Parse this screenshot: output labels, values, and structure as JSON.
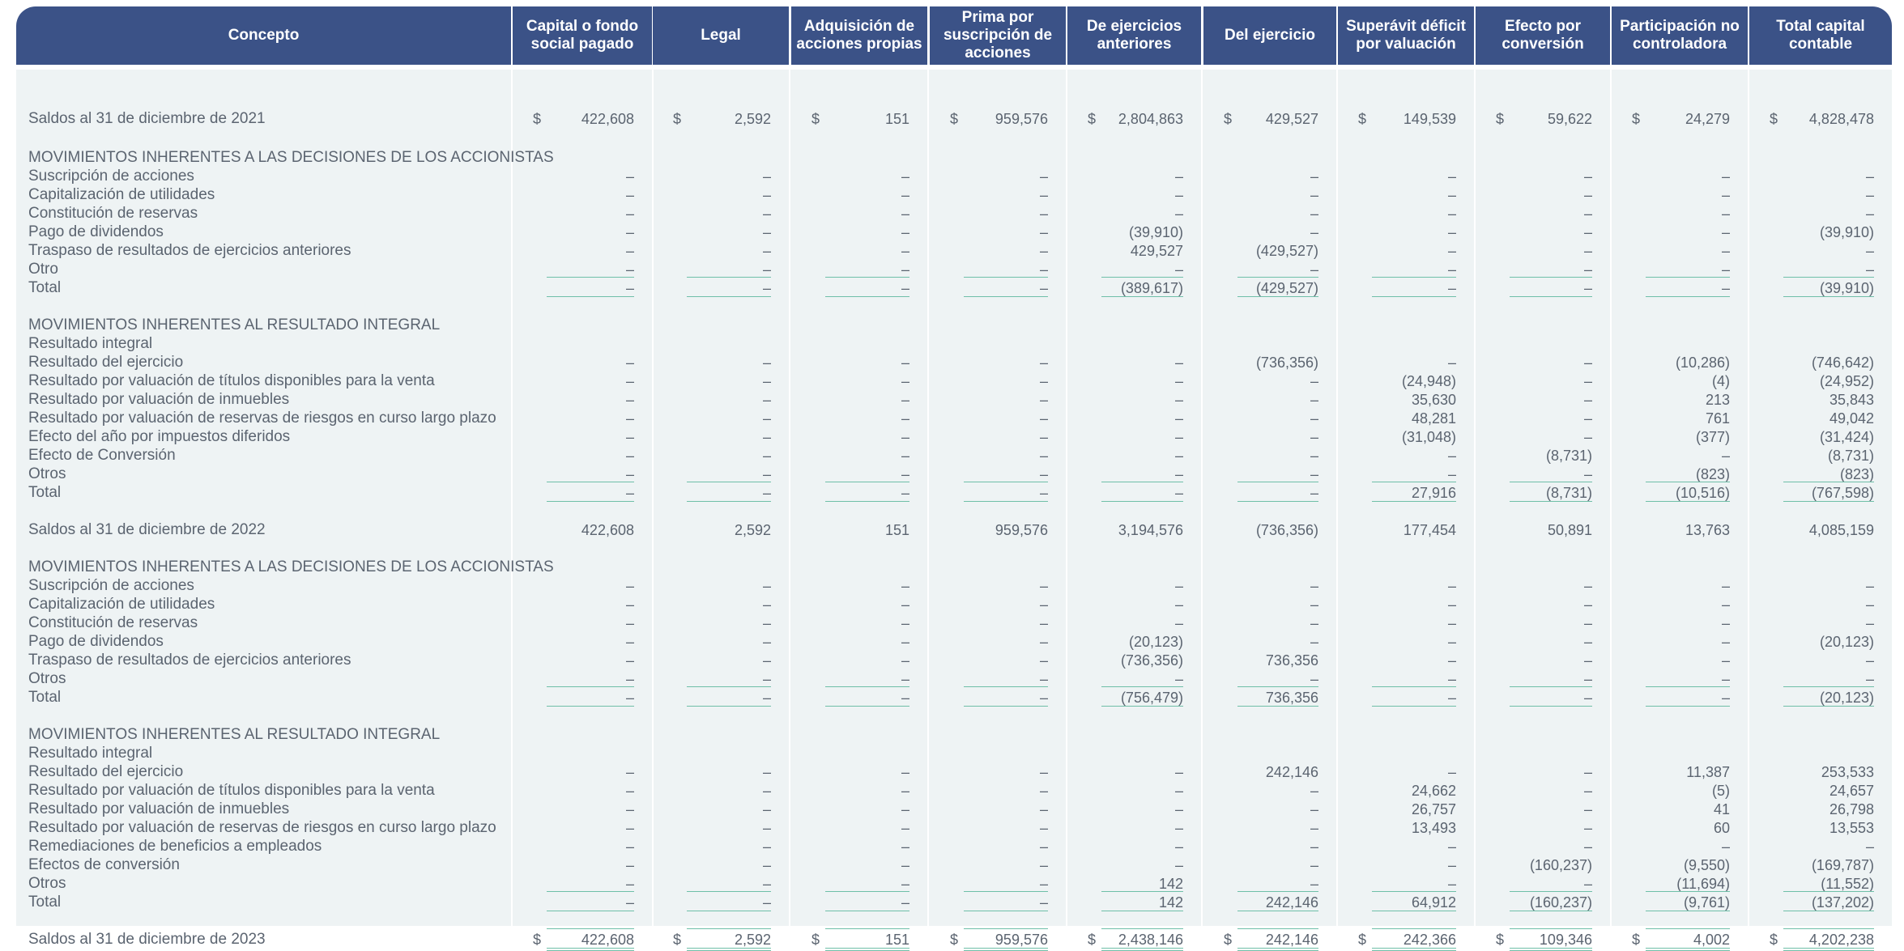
{
  "headers": [
    "Concepto",
    "Capital o fondo social pagado",
    "Legal",
    "Adquisición de acciones propias",
    "Prima por suscripción de acciones",
    "De ejercicios anteriores",
    "Del ejercicio",
    "Superávit déficit por valuación",
    "Efecto por conversión",
    "Participación no controladora",
    "Total capital contable"
  ],
  "currency_symbol": "$",
  "rows": [
    {
      "label": "Saldos al 31 de diciembre de 2021",
      "style": "dollar",
      "values": [
        "422,608",
        "2,592",
        "151",
        "959,576",
        "2,804,863",
        "429,527",
        "149,539",
        "59,622",
        "24,279",
        "4,828,478"
      ]
    },
    {
      "label": "MOVIMIENTOS INHERENTES A LAS DECISIONES DE LOS ACCIONISTAS",
      "style": "section",
      "values": []
    },
    {
      "label": "Suscripción de acciones",
      "values": [
        "–",
        "–",
        "–",
        "–",
        "–",
        "–",
        "–",
        "–",
        "–",
        "–"
      ]
    },
    {
      "label": "Capitalización de utilidades",
      "values": [
        "–",
        "–",
        "–",
        "–",
        "–",
        "–",
        "–",
        "–",
        "–",
        "–"
      ]
    },
    {
      "label": "Constitución de reservas",
      "values": [
        "–",
        "–",
        "–",
        "–",
        "–",
        "–",
        "–",
        "–",
        "–",
        "–"
      ]
    },
    {
      "label": "Pago de dividendos",
      "values": [
        "–",
        "–",
        "–",
        "–",
        "(39,910)",
        "–",
        "–",
        "–",
        "–",
        "(39,910)"
      ]
    },
    {
      "label": "Traspaso de resultados de ejercicios anteriores",
      "values": [
        "–",
        "–",
        "–",
        "–",
        "429,527",
        "(429,527)",
        "–",
        "–",
        "–",
        "–"
      ]
    },
    {
      "label": "Otro",
      "values": [
        "–",
        "–",
        "–",
        "–",
        "–",
        "–",
        "–",
        "–",
        "–",
        "–"
      ]
    },
    {
      "label": "Total",
      "style": "total",
      "values": [
        "–",
        "–",
        "–",
        "–",
        "(389,617)",
        "(429,527)",
        "–",
        "–",
        "–",
        "(39,910)"
      ]
    },
    {
      "label": "MOVIMIENTOS INHERENTES AL RESULTADO INTEGRAL",
      "style": "section",
      "values": []
    },
    {
      "label": "Resultado integral",
      "values": [
        "",
        "",
        "",
        "",
        "",
        "",
        "",
        "",
        "",
        ""
      ]
    },
    {
      "label": "Resultado del ejercicio",
      "values": [
        "–",
        "–",
        "–",
        "–",
        "–",
        "(736,356)",
        "–",
        "–",
        "(10,286)",
        "(746,642)"
      ]
    },
    {
      "label": "Resultado por valuación de títulos disponibles para la venta",
      "values": [
        "–",
        "–",
        "–",
        "–",
        "–",
        "–",
        "(24,948)",
        "–",
        "(4)",
        "(24,952)"
      ]
    },
    {
      "label": "Resultado por valuación de inmuebles",
      "values": [
        "–",
        "–",
        "–",
        "–",
        "–",
        "–",
        "35,630",
        "–",
        "213",
        "35,843"
      ]
    },
    {
      "label": "Resultado por valuación de reservas de riesgos en curso largo plazo",
      "values": [
        "–",
        "–",
        "–",
        "–",
        "–",
        "–",
        "48,281",
        "–",
        "761",
        "49,042"
      ]
    },
    {
      "label": "Efecto del año por impuestos diferidos",
      "values": [
        "–",
        "–",
        "–",
        "–",
        "–",
        "–",
        "(31,048)",
        "–",
        "(377)",
        "(31,424)"
      ]
    },
    {
      "label": "Efecto de Conversión",
      "values": [
        "–",
        "–",
        "–",
        "–",
        "–",
        "–",
        "–",
        "(8,731)",
        "–",
        "(8,731)"
      ]
    },
    {
      "label": "Otros",
      "values": [
        "–",
        "–",
        "–",
        "–",
        "–",
        "–",
        "–",
        "–",
        "(823)",
        "(823)"
      ]
    },
    {
      "label": "Total",
      "style": "total",
      "values": [
        "–",
        "–",
        "–",
        "–",
        "–",
        "–",
        "27,916",
        "(8,731)",
        "(10,516)",
        "(767,598)"
      ]
    },
    {
      "label": "Saldos al 31 de diciembre de 2022",
      "style": "balance",
      "values": [
        "422,608",
        "2,592",
        "151",
        "959,576",
        "3,194,576",
        "(736,356)",
        "177,454",
        "50,891",
        "13,763",
        "4,085,159"
      ]
    },
    {
      "label": "MOVIMIENTOS INHERENTES A LAS DECISIONES DE LOS ACCIONISTAS",
      "style": "section",
      "values": []
    },
    {
      "label": "Suscripción de acciones",
      "values": [
        "–",
        "–",
        "–",
        "–",
        "–",
        "–",
        "–",
        "–",
        "–",
        "–"
      ]
    },
    {
      "label": "Capitalización de utilidades",
      "values": [
        "–",
        "–",
        "–",
        "–",
        "–",
        "–",
        "–",
        "–",
        "–",
        "–"
      ]
    },
    {
      "label": "Constitución de reservas",
      "values": [
        "–",
        "–",
        "–",
        "–",
        "–",
        "–",
        "–",
        "–",
        "–",
        "–"
      ]
    },
    {
      "label": "Pago de dividendos",
      "values": [
        "–",
        "–",
        "–",
        "–",
        "(20,123)",
        "–",
        "–",
        "–",
        "–",
        "(20,123)"
      ]
    },
    {
      "label": "Traspaso de resultados de ejercicios anteriores",
      "values": [
        "–",
        "–",
        "–",
        "–",
        "(736,356)",
        "736,356",
        "–",
        "–",
        "–",
        "–"
      ]
    },
    {
      "label": "Otros",
      "values": [
        "–",
        "–",
        "–",
        "–",
        "–",
        "–",
        "–",
        "–",
        "–",
        "–"
      ]
    },
    {
      "label": "Total",
      "style": "total",
      "values": [
        "–",
        "–",
        "–",
        "–",
        "(756,479)",
        "736,356",
        "–",
        "–",
        "–",
        "(20,123)"
      ]
    },
    {
      "label": "MOVIMIENTOS INHERENTES AL RESULTADO INTEGRAL",
      "style": "section",
      "values": []
    },
    {
      "label": "Resultado integral",
      "values": [
        "",
        "",
        "",
        "",
        "",
        "",
        "",
        "",
        "",
        ""
      ]
    },
    {
      "label": "Resultado del ejercicio",
      "values": [
        "–",
        "–",
        "–",
        "–",
        "–",
        "242,146",
        "–",
        "–",
        "11,387",
        "253,533"
      ]
    },
    {
      "label": "Resultado por valuación de títulos disponibles para la venta",
      "values": [
        "–",
        "–",
        "–",
        "–",
        "–",
        "–",
        "24,662",
        "–",
        "(5)",
        "24,657"
      ]
    },
    {
      "label": "Resultado por valuación de inmuebles",
      "values": [
        "–",
        "–",
        "–",
        "–",
        "–",
        "–",
        "26,757",
        "–",
        "41",
        "26,798"
      ]
    },
    {
      "label": "Resultado por valuación de reservas de riesgos en curso largo plazo",
      "values": [
        "–",
        "–",
        "–",
        "–",
        "–",
        "–",
        "13,493",
        "–",
        "60",
        "13,553"
      ]
    },
    {
      "label": "Remediaciones de beneficios a empleados",
      "values": [
        "–",
        "–",
        "–",
        "–",
        "–",
        "–",
        "–",
        "–",
        "–",
        "–"
      ]
    },
    {
      "label": "Efectos de conversión",
      "values": [
        "–",
        "–",
        "–",
        "–",
        "–",
        "–",
        "–",
        "(160,237)",
        "(9,550)",
        "(169,787)"
      ]
    },
    {
      "label": "Otros",
      "values": [
        "–",
        "–",
        "–",
        "–",
        "142",
        "–",
        "–",
        "–",
        "(11,694)",
        "(11,552)"
      ]
    },
    {
      "label": "Total",
      "style": "total",
      "values": [
        "–",
        "–",
        "–",
        "–",
        "142",
        "242,146",
        "64,912",
        "(160,237)",
        "(9,761)",
        "(137,202)"
      ]
    },
    {
      "label": "Saldos al 31 de diciembre de 2023",
      "style": "dollar_final",
      "values": [
        "422,608",
        "2,592",
        "151",
        "959,576",
        "2,438,146",
        "242,146",
        "242,366",
        "109,346",
        "4,002",
        "4,202,238"
      ]
    }
  ]
}
